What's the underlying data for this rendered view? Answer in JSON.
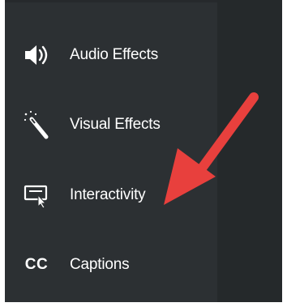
{
  "sidebar": {
    "items": [
      {
        "id": "audio",
        "label": "Audio Effects",
        "icon": "speaker-icon"
      },
      {
        "id": "visual",
        "label": "Visual Effects",
        "icon": "magic-wand-icon"
      },
      {
        "id": "interactivity",
        "label": "Interactivity",
        "icon": "interactivity-icon"
      },
      {
        "id": "captions",
        "label": "Captions",
        "icon": "cc-icon",
        "icon_text": "CC"
      }
    ]
  },
  "annotation": {
    "arrow_color": "#e8403d"
  },
  "colors": {
    "sidebar_bg": "#2c3033",
    "right_panel_bg": "#25292b",
    "text": "#ffffff"
  }
}
